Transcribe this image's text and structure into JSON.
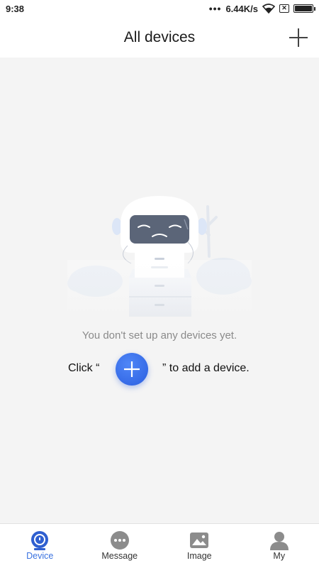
{
  "status_bar": {
    "time": "9:38",
    "dots": "•••",
    "network_speed": "6.44K/s",
    "wifi_icon": "wifi-icon",
    "sim_icon": "no-sim-icon",
    "battery_icon": "battery-icon"
  },
  "header": {
    "title": "All devices",
    "add_icon": "plus-icon"
  },
  "main": {
    "illustration": "empty-robot-illustration",
    "empty_message": "You don't set up any devices yet.",
    "hint_prefix": "Click “",
    "hint_suffix": "” to add a device.",
    "hint_button_icon": "plus-icon"
  },
  "tabs": [
    {
      "label": "Device",
      "icon": "camera-icon",
      "active": true
    },
    {
      "label": "Message",
      "icon": "message-icon",
      "active": false
    },
    {
      "label": "Image",
      "icon": "image-icon",
      "active": false
    },
    {
      "label": "My",
      "icon": "person-icon",
      "active": false
    }
  ],
  "colors": {
    "accent": "#3a72e0",
    "background": "#f4f4f4",
    "tab_icon_inactive": "#8c8c8c"
  }
}
